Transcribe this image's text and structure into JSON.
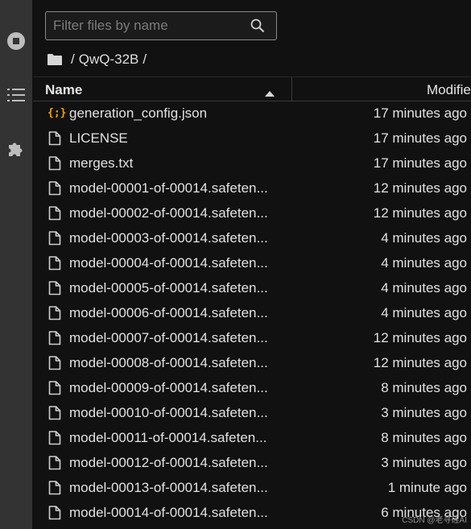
{
  "search": {
    "placeholder": "Filter files by name"
  },
  "breadcrumb": {
    "separator_left": "/",
    "folder": "QwQ-32B",
    "separator_right": "/"
  },
  "table": {
    "columns": {
      "name": "Name",
      "modified": "Modified"
    },
    "sort": "name-ascending",
    "rows": [
      {
        "name": "generation_config.json",
        "modified": "17 minutes ago",
        "icon": "json-icon"
      },
      {
        "name": "LICENSE",
        "modified": "17 minutes ago",
        "icon": "file-icon"
      },
      {
        "name": "merges.txt",
        "modified": "17 minutes ago",
        "icon": "file-icon"
      },
      {
        "name": "model-00001-of-00014.safeten...",
        "modified": "12 minutes ago",
        "icon": "file-icon"
      },
      {
        "name": "model-00002-of-00014.safeten...",
        "modified": "12 minutes ago",
        "icon": "file-icon"
      },
      {
        "name": "model-00003-of-00014.safeten...",
        "modified": "4 minutes ago",
        "icon": "file-icon"
      },
      {
        "name": "model-00004-of-00014.safeten...",
        "modified": "4 minutes ago",
        "icon": "file-icon"
      },
      {
        "name": "model-00005-of-00014.safeten...",
        "modified": "4 minutes ago",
        "icon": "file-icon"
      },
      {
        "name": "model-00006-of-00014.safeten...",
        "modified": "4 minutes ago",
        "icon": "file-icon"
      },
      {
        "name": "model-00007-of-00014.safeten...",
        "modified": "12 minutes ago",
        "icon": "file-icon"
      },
      {
        "name": "model-00008-of-00014.safeten...",
        "modified": "12 minutes ago",
        "icon": "file-icon"
      },
      {
        "name": "model-00009-of-00014.safeten...",
        "modified": "8 minutes ago",
        "icon": "file-icon"
      },
      {
        "name": "model-00010-of-00014.safeten...",
        "modified": "3 minutes ago",
        "icon": "file-icon"
      },
      {
        "name": "model-00011-of-00014.safeten...",
        "modified": "8 minutes ago",
        "icon": "file-icon"
      },
      {
        "name": "model-00012-of-00014.safeten...",
        "modified": "3 minutes ago",
        "icon": "file-icon"
      },
      {
        "name": "model-00013-of-00014.safeten...",
        "modified": "1 minute ago",
        "icon": "file-icon"
      },
      {
        "name": "model-00014-of-00014.safeten...",
        "modified": "6 minutes ago",
        "icon": "file-icon"
      }
    ]
  },
  "sidebar": {
    "icons": [
      "running-sessions-icon",
      "table-of-contents-icon",
      "extensions-icon"
    ]
  },
  "watermark": "CSDN @老寻硅AI",
  "colors": {
    "background": "#111111",
    "sidebar": "#333333",
    "text": "#e2e2e2",
    "json_accent": "#f0a30a"
  }
}
